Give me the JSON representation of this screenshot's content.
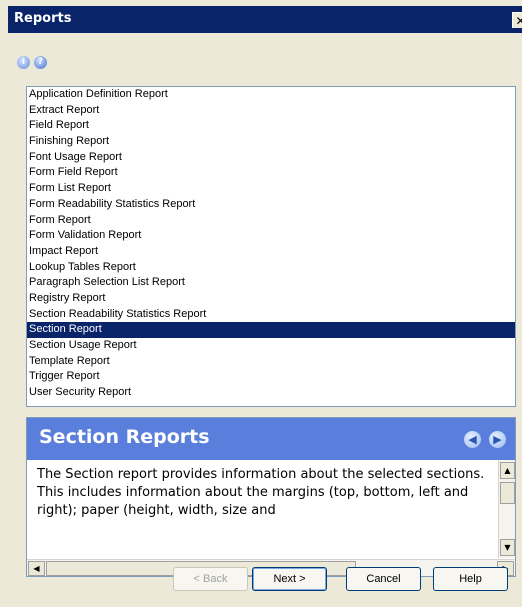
{
  "window": {
    "title": "Reports",
    "close_glyph": "✕"
  },
  "toolbar": {
    "icons": [
      "info-icon",
      "help-icon"
    ]
  },
  "report_list": {
    "items": [
      "Application Definition Report",
      "Extract Report",
      "Field Report",
      "Finishing Report",
      "Font Usage Report",
      "Form Field Report",
      "Form List Report",
      "Form Readability Statistics Report",
      "Form Report",
      "Form Validation Report",
      "Impact Report",
      "Lookup Tables Report",
      "Paragraph Selection List Report",
      "Registry Report",
      "Section Readability Statistics Report",
      "Section Report",
      "Section Usage Report",
      "Template Report",
      "Trigger Report",
      "User Security Report"
    ],
    "selected": "Section Report"
  },
  "help_panel": {
    "title": "Section Reports",
    "text": "The Section report provides information about the selected sections. This includes information about the margins (top, bottom, left and right); paper (height, width, size and"
  },
  "buttons": {
    "back": "< Back",
    "next": "Next >",
    "cancel": "Cancel",
    "help": "Help"
  },
  "colors": {
    "title_bar": "#0a246a",
    "selection": "#0a246a",
    "help_header": "#5a7edc"
  }
}
